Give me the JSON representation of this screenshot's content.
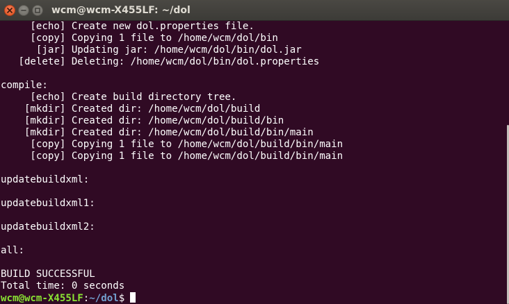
{
  "window": {
    "title": "wcm@wcm-X455LF: ~/dol"
  },
  "terminal": {
    "lines": [
      "     [echo] Create new dol.properties file.",
      "     [copy] Copying 1 file to /home/wcm/dol/bin",
      "      [jar] Updating jar: /home/wcm/dol/bin/dol.jar",
      "   [delete] Deleting: /home/wcm/dol/bin/dol.properties",
      "",
      "compile:",
      "     [echo] Create build directory tree.",
      "    [mkdir] Created dir: /home/wcm/dol/build",
      "    [mkdir] Created dir: /home/wcm/dol/build/bin",
      "    [mkdir] Created dir: /home/wcm/dol/build/bin/main",
      "     [copy] Copying 1 file to /home/wcm/dol/build/bin/main",
      "     [copy] Copying 1 file to /home/wcm/dol/build/bin/main",
      "",
      "updatebuildxml:",
      "",
      "updatebuildxml1:",
      "",
      "updatebuildxml2:",
      "",
      "all:",
      "",
      "BUILD SUCCESSFUL",
      "Total time: 0 seconds"
    ],
    "prompt": {
      "user_host": "wcm@wcm-X455LF",
      "separator": ":",
      "path": "~/dol",
      "symbol": "$"
    }
  },
  "colors": {
    "background": "#300a24",
    "text": "#ffffff",
    "prompt_user": "#8ae234",
    "prompt_path": "#729fcf",
    "titlebar": "#3c3b37",
    "close_button": "#e2531d"
  },
  "icons": {
    "close": "close-icon",
    "minimize": "minimize-icon",
    "maximize": "maximize-icon"
  }
}
